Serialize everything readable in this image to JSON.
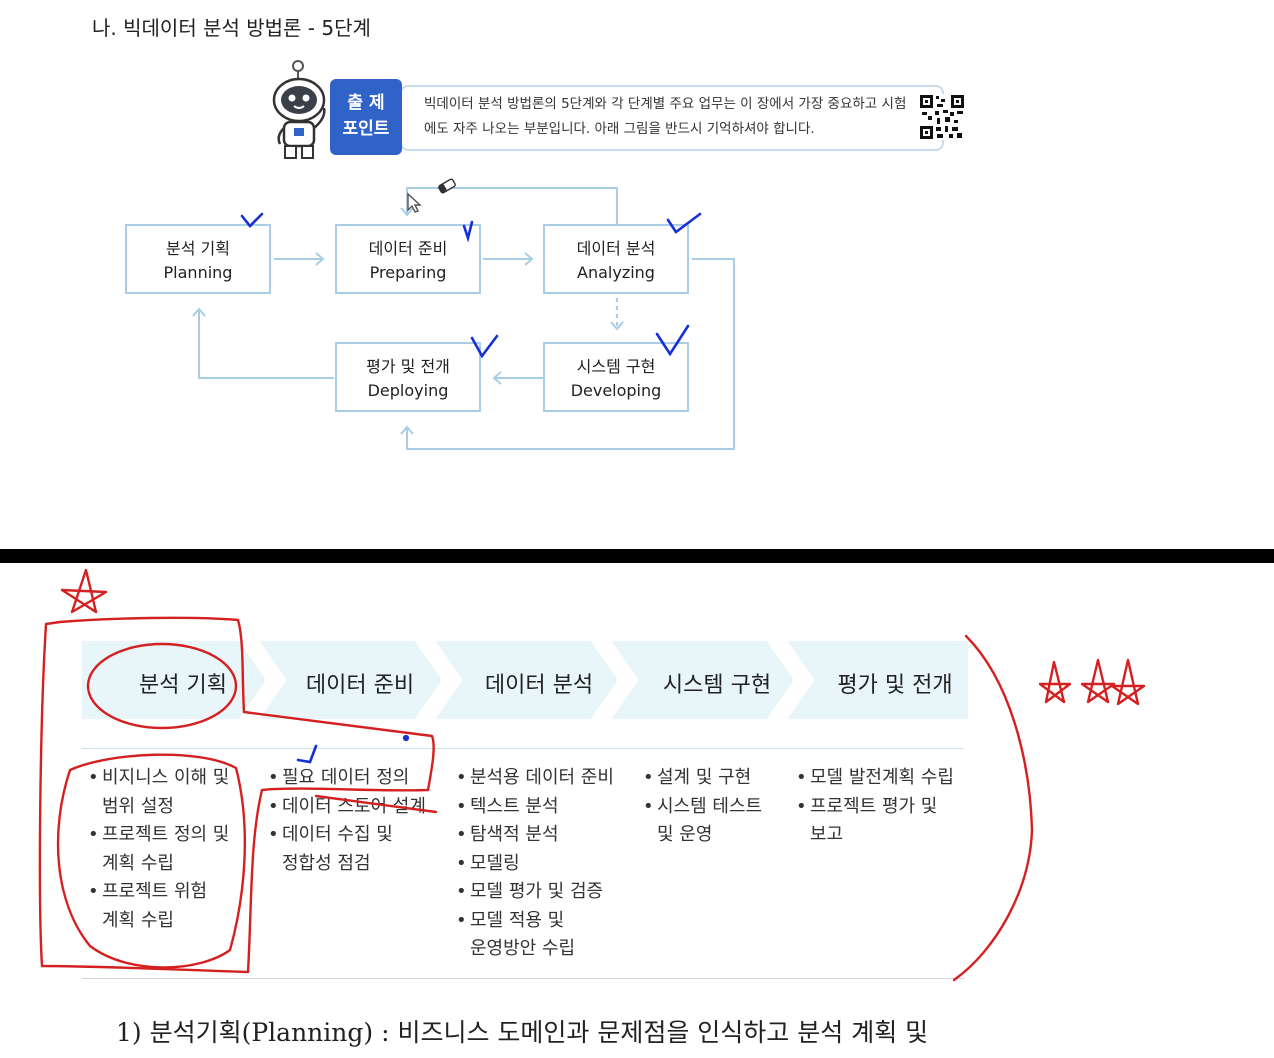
{
  "section_title": "나. 빅데이터 분석 방법론 - 5단계",
  "point_badge": {
    "line1": "출 제",
    "line2": "포인트"
  },
  "point_text": "빅데이터 분석 방법론의 5단계와 각 단계별 주요 업무는 이 장에서 가장 중요하고 시험에도 자주 나오는 부분입니다. 아래 그림을 반드시 기억하셔야 합니다.",
  "stages": [
    {
      "ko": "분석 기획",
      "en": "Planning"
    },
    {
      "ko": "데이터 준비",
      "en": "Preparing"
    },
    {
      "ko": "데이터 분석",
      "en": "Analyzing"
    },
    {
      "ko": "시스템 구현",
      "en": "Developing"
    },
    {
      "ko": "평가 및 전개",
      "en": "Deploying"
    }
  ],
  "phases": [
    "분석 기획",
    "데이터 준비",
    "데이터 분석",
    "시스템 구현",
    "평가 및 전개"
  ],
  "tasks": [
    [
      "비지니스 이해 및 범위 설정",
      "프로젝트 정의 및 계획 수립",
      "프로젝트 위험 계획 수립"
    ],
    [
      "필요 데이터 정의",
      "데이터 스토어 설계",
      "데이터 수집 및 정합성 점검"
    ],
    [
      "분석용 데이터 준비",
      "텍스트 분석",
      "탐색적 분석",
      "모델링",
      "모델 평가 및 검증",
      "모델 적용 및 운영방안 수립"
    ],
    [
      "설계 및 구현",
      "시스템 테스트 및 운영"
    ],
    [
      "모델 발전계획 수립",
      "프로젝트 평가 및 보고"
    ]
  ],
  "tasks_display": {
    "c0": [
      "비지니스 이해 및",
      "범위 설정",
      "프로젝트 정의 및",
      "계획 수립",
      "프로젝트 위험",
      "계획 수립"
    ],
    "c1": [
      "필요 데이터 정의",
      "데이터 스토어 설계",
      "데이터 수집 및",
      "정합성 점검"
    ],
    "c2": [
      "분석용 데이터 준비",
      "텍스트 분석",
      "탐색적 분석",
      "모델링",
      "모델 평가 및 검증",
      "모델 적용 및",
      "운영방안 수립"
    ],
    "c3": [
      "설계 및 구현",
      "시스템 테스트",
      "및 운영"
    ],
    "c4": [
      "모델 발전계획 수립",
      "프로젝트 평가 및",
      "보고"
    ]
  },
  "footer_text": "1) 분석기획(Planning) : 비즈니스 도메인과 문제점을 인식하고 분석 계획 및",
  "colors": {
    "badge": "#2f63c8",
    "stage_border": "#a8cde4",
    "annotation_red": "#d42020",
    "annotation_blue": "#1530d8"
  },
  "icons": [
    "mascot-icon",
    "qr-code-icon",
    "eraser-cursor-icon",
    "pointer-cursor-icon"
  ]
}
